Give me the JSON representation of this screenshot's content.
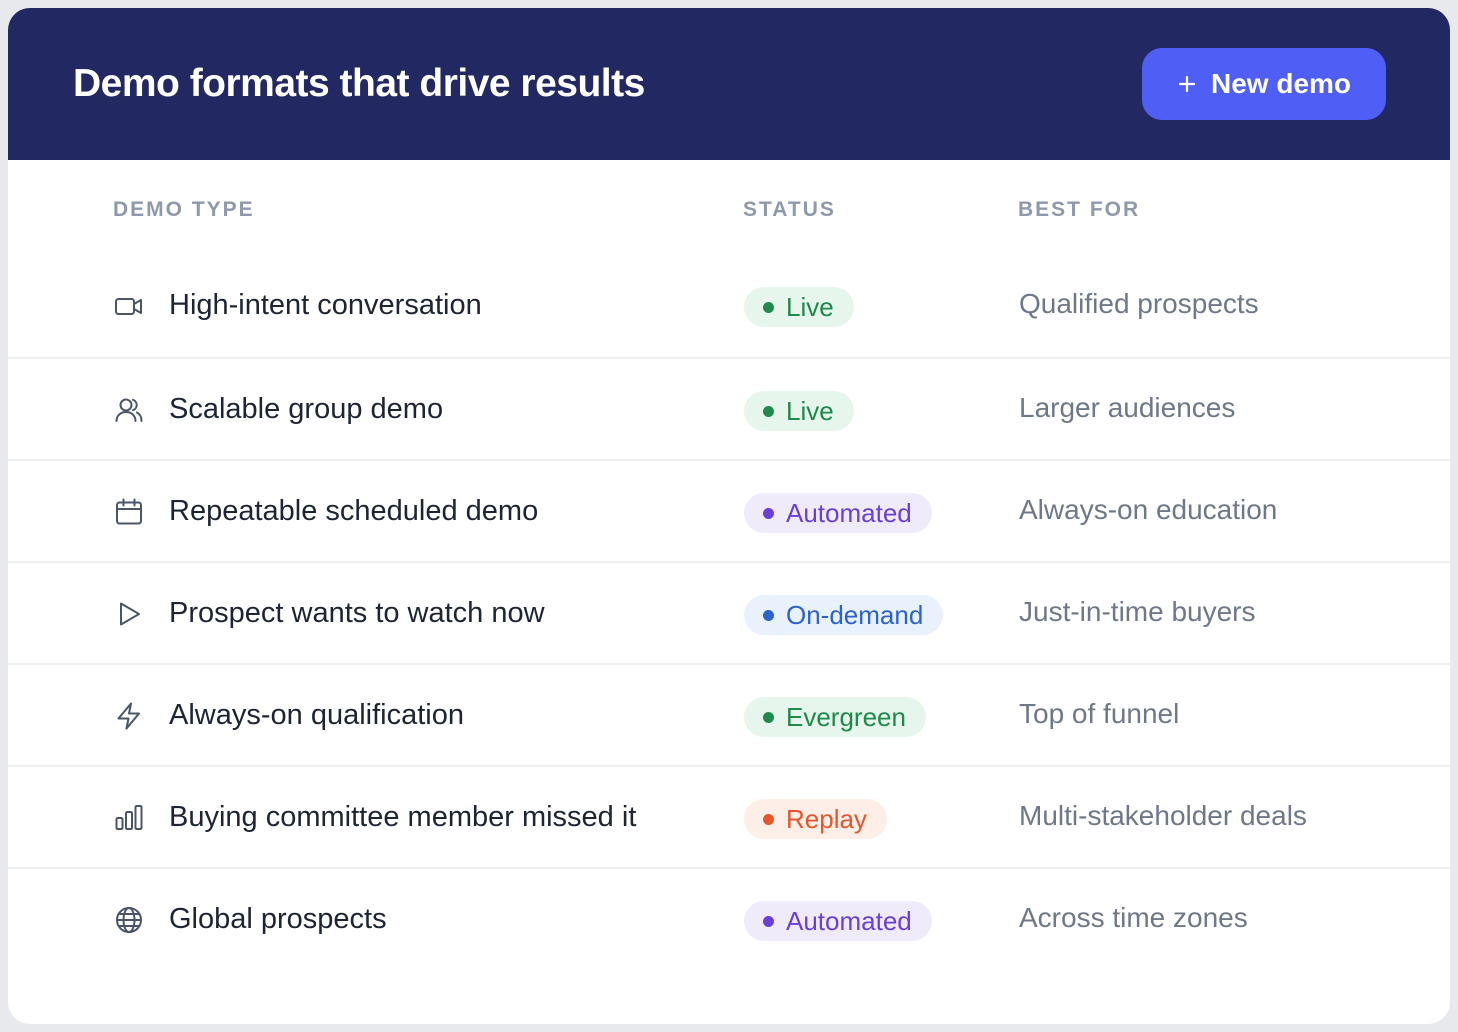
{
  "header": {
    "title": "Demo formats that drive results",
    "new_button_label": "New demo",
    "background": "#222862",
    "button_color": "#4f5ff5"
  },
  "columns": [
    "DEMO TYPE",
    "STATUS",
    "BEST FOR"
  ],
  "rows": [
    {
      "icon": "video-icon",
      "title": "High-intent conversation",
      "status": "Live",
      "status_kind": "live",
      "best_for": "Qualified prospects"
    },
    {
      "icon": "users-icon",
      "title": "Scalable group demo",
      "status": "Live",
      "status_kind": "live",
      "best_for": "Larger audiences"
    },
    {
      "icon": "calendar-icon",
      "title": "Repeatable scheduled demo",
      "status": "Automated",
      "status_kind": "automated",
      "best_for": "Always-on education"
    },
    {
      "icon": "play-icon",
      "title": "Prospect wants to watch now",
      "status": "On-demand",
      "status_kind": "on-demand",
      "best_for": "Just-in-time buyers"
    },
    {
      "icon": "lightning-icon",
      "title": "Always-on qualification",
      "status": "Evergreen",
      "status_kind": "evergreen",
      "best_for": "Top of funnel"
    },
    {
      "icon": "bar-chart-icon",
      "title": "Buying committee member missed it",
      "status": "Replay",
      "status_kind": "replay",
      "best_for": "Multi-stakeholder deals"
    },
    {
      "icon": "globe-icon",
      "title": "Global prospects",
      "status": "Automated",
      "status_kind": "automated",
      "best_for": "Across time zones"
    }
  ],
  "status_colors": {
    "live": "#1e8a4a",
    "automated": "#6b3fd6",
    "on-demand": "#2c62cc",
    "evergreen": "#1e8a4a",
    "replay": "#e5572a"
  }
}
